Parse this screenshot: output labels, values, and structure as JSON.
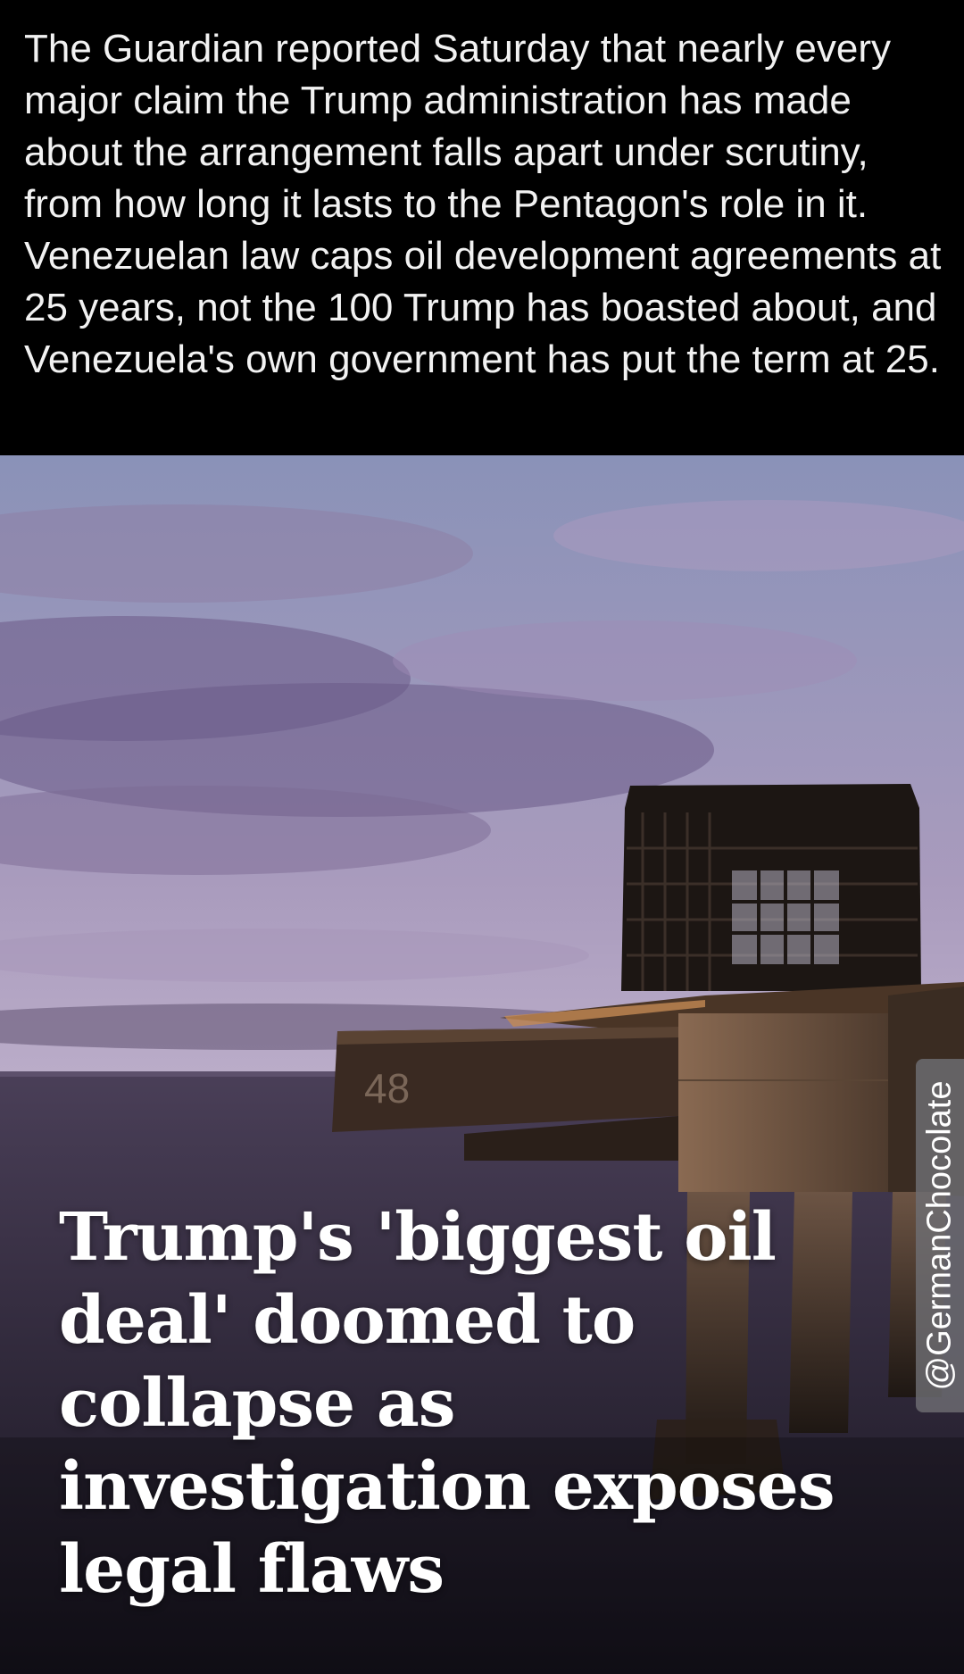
{
  "caption": {
    "text": "The Guardian reported Saturday that nearly every major claim the Trump administration has made about the arrangement falls apart under scrutiny, from how long it lasts to the Pentagon's role in it. Venezuelan law caps oil development agreements at 25 years, not the 100 Trump has boasted about, and Venezuela's own government has put the term at 25."
  },
  "watermark": {
    "text": "@GermanChocolate"
  },
  "photo": {
    "sign_number": "48",
    "colors": {
      "sky_top": "#7f86ab",
      "sky_mid": "#b7a6c4",
      "cloud": "#6a5a84",
      "water": "#2b2535",
      "platform": "#3a2c22",
      "concrete": "#6b5443"
    }
  },
  "headline": {
    "text": "Trump's 'biggest oil deal' doomed to collapse as investigation exposes legal flaws"
  }
}
